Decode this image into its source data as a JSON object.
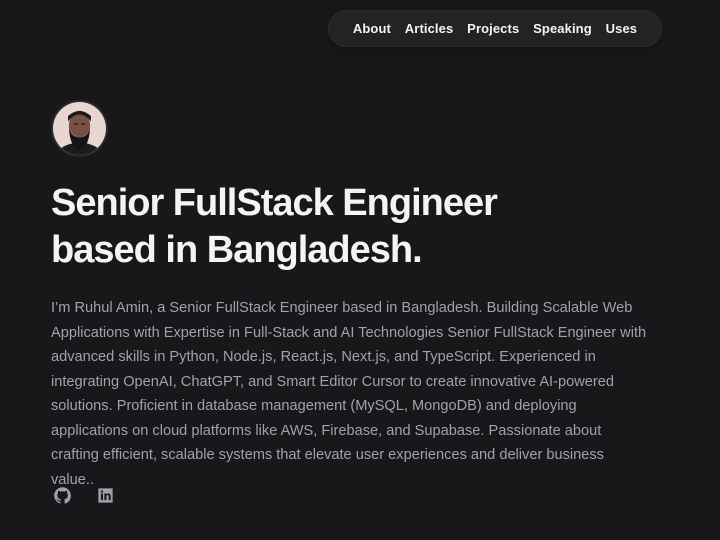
{
  "nav": {
    "items": [
      {
        "label": "About"
      },
      {
        "label": "Articles"
      },
      {
        "label": "Projects"
      },
      {
        "label": "Speaking"
      },
      {
        "label": "Uses"
      }
    ]
  },
  "profile": {
    "avatar_alt": "Ruhul Amin avatar"
  },
  "hero": {
    "title_line1": "Senior FullStack Engineer",
    "title_line2": "based in Bangladesh.",
    "bio": "I’m Ruhul Amin, a Senior FullStack Engineer based in Bangladesh. Building Scalable Web Applications with Expertise in Full-Stack and AI Technologies Senior FullStack Engineer with advanced skills in Python, Node.js, React.js, Next.js, and TypeScript. Experienced in integrating OpenAI, ChatGPT, and Smart Editor Cursor to create innovative AI-powered solutions. Proficient in database management (MySQL, MongoDB) and deploying applications on cloud platforms like AWS, Firebase, and Supabase. Passionate about crafting efficient, scalable systems that elevate user experiences and deliver business value.."
  },
  "socials": [
    {
      "name": "github",
      "icon": "github-icon"
    },
    {
      "name": "linkedin",
      "icon": "linkedin-icon"
    }
  ],
  "colors": {
    "background": "#18181b",
    "nav_background": "#232326",
    "heading": "#f4f4f5",
    "body_text": "#a1a1aa"
  }
}
